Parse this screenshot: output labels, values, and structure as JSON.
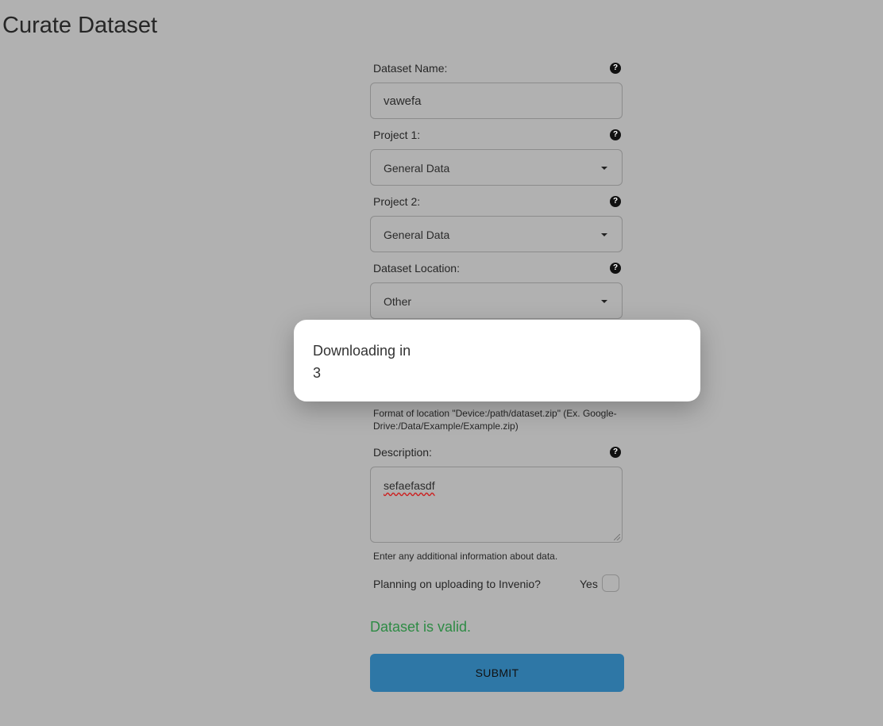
{
  "page": {
    "title": "Curate Dataset"
  },
  "form": {
    "dataset_name": {
      "label": "Dataset Name:",
      "value": "vawefa",
      "help_icon": "question-circle-icon"
    },
    "project1": {
      "label": "Project 1:",
      "value": "General Data",
      "help_icon": "question-circle-icon"
    },
    "project2": {
      "label": "Project 2:",
      "value": "General Data",
      "help_icon": "question-circle-icon"
    },
    "location": {
      "label": "Dataset Location:",
      "value": "Other",
      "help_icon": "question-circle-icon",
      "hint": "Format of location \"Device:/path/dataset.zip\" (Ex. Google-Drive:/Data/Example/Example.zip)"
    },
    "description": {
      "label": "Description:",
      "value": "sefaefasdf",
      "help_icon": "question-circle-icon",
      "hint": "Enter any additional information about data."
    },
    "invenio": {
      "label": "Planning on uploading to Invenio?",
      "option_label": "Yes",
      "checked": false
    },
    "status": {
      "text": "Dataset is valid.",
      "color": "#2e8b45"
    },
    "submit_label": "SUBMIT"
  },
  "modal": {
    "title": "Downloading in",
    "countdown": "3"
  },
  "colors": {
    "background_overlay": "#b1b1b1",
    "submit": "#2e77a6",
    "modal": "#ffffff"
  }
}
